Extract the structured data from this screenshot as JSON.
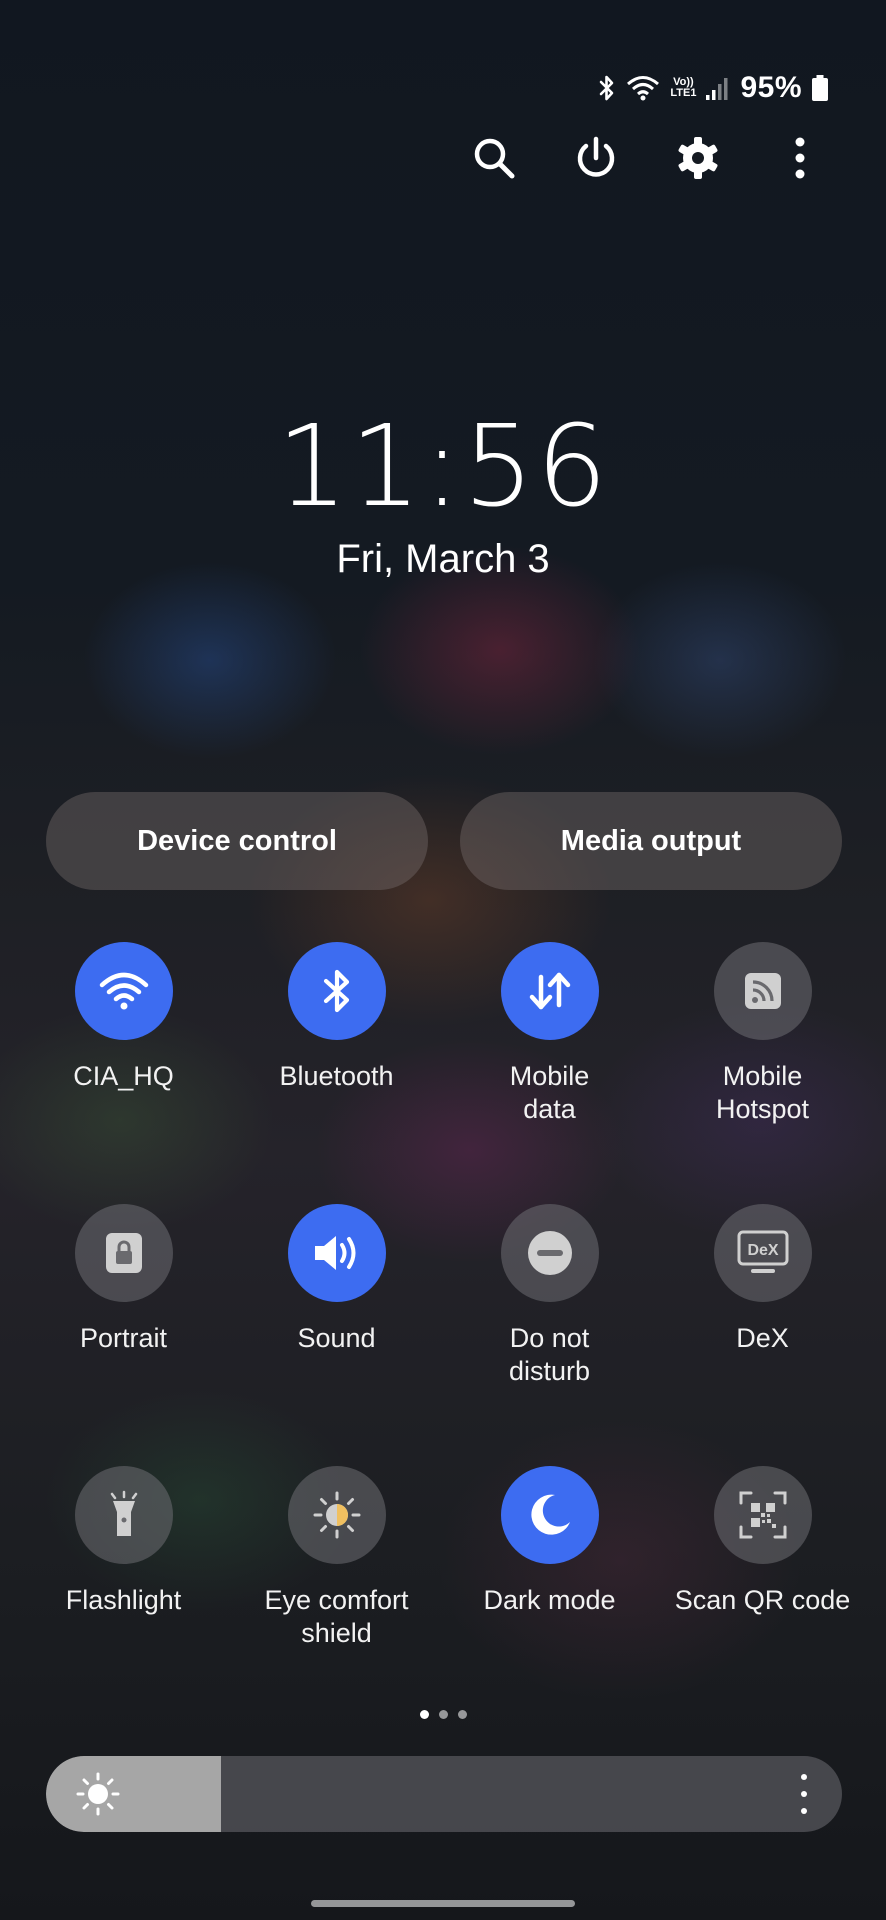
{
  "status_bar": {
    "icons": [
      "bluetooth-icon",
      "wifi-icon",
      "volte-icon",
      "signal-icon",
      "battery-icon"
    ],
    "volte_text_top": "Vo))",
    "volte_text_bottom": "LTE1",
    "battery_percent": "95%"
  },
  "top_actions": [
    "search-icon",
    "power-icon",
    "settings-gear-icon",
    "more-vertical-icon"
  ],
  "clock": {
    "time": "11:56",
    "date": "Fri, March 3"
  },
  "pills": {
    "device_control": "Device control",
    "media_output": "Media output"
  },
  "tiles": [
    {
      "label": "CIA_HQ",
      "icon": "wifi-icon",
      "on": true
    },
    {
      "label": "Bluetooth",
      "icon": "bluetooth-icon",
      "on": true
    },
    {
      "label": "Mobile\ndata",
      "icon": "mobile-data-icon",
      "on": true
    },
    {
      "label": "Mobile\nHotspot",
      "icon": "hotspot-icon",
      "on": false
    },
    {
      "label": "Portrait",
      "icon": "rotation-lock-icon",
      "on": false
    },
    {
      "label": "Sound",
      "icon": "sound-icon",
      "on": true
    },
    {
      "label": "Do not\ndisturb",
      "icon": "do-not-disturb-icon",
      "on": false
    },
    {
      "label": "DeX",
      "icon": "dex-icon",
      "on": false
    },
    {
      "label": "Flashlight",
      "icon": "flashlight-icon",
      "on": false
    },
    {
      "label": "Eye comfort\nshield",
      "icon": "eye-comfort-icon",
      "on": false
    },
    {
      "label": "Dark mode",
      "icon": "dark-mode-icon",
      "on": true
    },
    {
      "label": "Scan QR code",
      "icon": "qr-scan-icon",
      "on": false
    }
  ],
  "dex_icon_text": "DeX",
  "page_indicator": {
    "pages": 3,
    "current": 1
  },
  "brightness": {
    "level": 0.22,
    "icon": "brightness-sun-icon"
  },
  "colors": {
    "accent_on": "#3d6cf1",
    "tile_off": "#6e6e72"
  }
}
